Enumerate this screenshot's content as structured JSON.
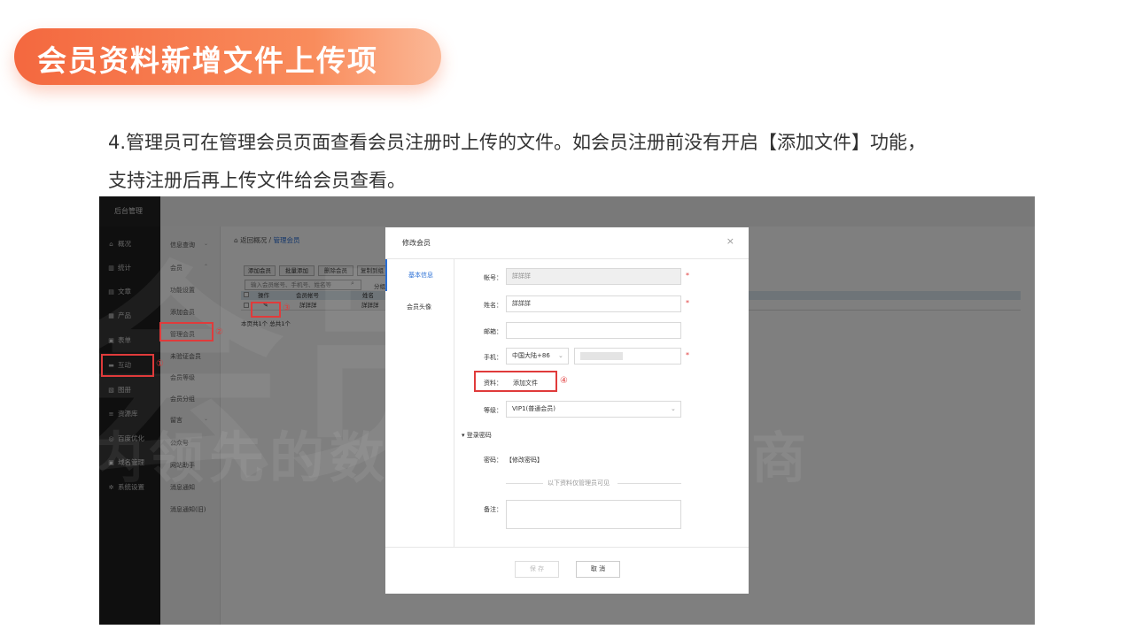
{
  "slide": {
    "title": "会员资料新增文件上传项",
    "desc_line1": "4.管理员可在管理会员页面查看会员注册时上传的文件。如会员注册前没有开启【添加文件】功能，",
    "desc_line2": "支持注册后再上传文件给会员查看。"
  },
  "sidebar": {
    "title": "后台管理",
    "items": [
      "概况",
      "统计",
      "文章",
      "产品",
      "表单",
      "互动",
      "图册",
      "资源库",
      "百度优化",
      "域名管理",
      "系统设置"
    ]
  },
  "submenu": {
    "items": [
      "信息查询",
      "会员",
      "功能设置",
      "添加会员",
      "管理会员",
      "未验证会员",
      "会员等级",
      "会员分组",
      "留言",
      "公众号",
      "网站助手",
      "消息通知",
      "消息通知(旧)"
    ]
  },
  "content": {
    "breadcrumb_home": "返回概况",
    "breadcrumb_sep": "/",
    "breadcrumb_current": "管理会员",
    "toolbar": [
      "添加会员",
      "批量添加",
      "删除会员",
      "复制到组"
    ],
    "search_placeholder": "输入会员帐号、手机号、姓名等",
    "group_label": "分组",
    "headers": [
      "操作",
      "会员帐号",
      "姓名"
    ],
    "row": {
      "account": "詳詳詳",
      "name": "詳詳詳"
    },
    "pager": "本页共1个 总共1个"
  },
  "annotations": [
    "①",
    "②",
    "③",
    "④"
  ],
  "watermark": {
    "line1": "会员",
    "line2": "国内领先的数字化营销服务商"
  },
  "modal": {
    "title": "修改会员",
    "close": "×",
    "tabs": [
      "基本信息",
      "会员头像"
    ],
    "fields": {
      "account_label": "帐号：",
      "account_value": "詳詳詳",
      "name_label": "姓名：",
      "name_value": "詳詳詳",
      "email_label": "邮箱：",
      "phone_label": "手机：",
      "phone_region": "中国大陆+86",
      "file_label": "资料：",
      "file_link": "添加文件",
      "level_label": "等级：",
      "level_value": "VIP1(普通会员)",
      "section_login": "登录密码",
      "password_label": "密码：",
      "password_link": "【修改密码】",
      "admin_only": "以下资料仅管理员可见",
      "note_label": "备注："
    },
    "save": "保 存",
    "cancel": "取 消"
  }
}
